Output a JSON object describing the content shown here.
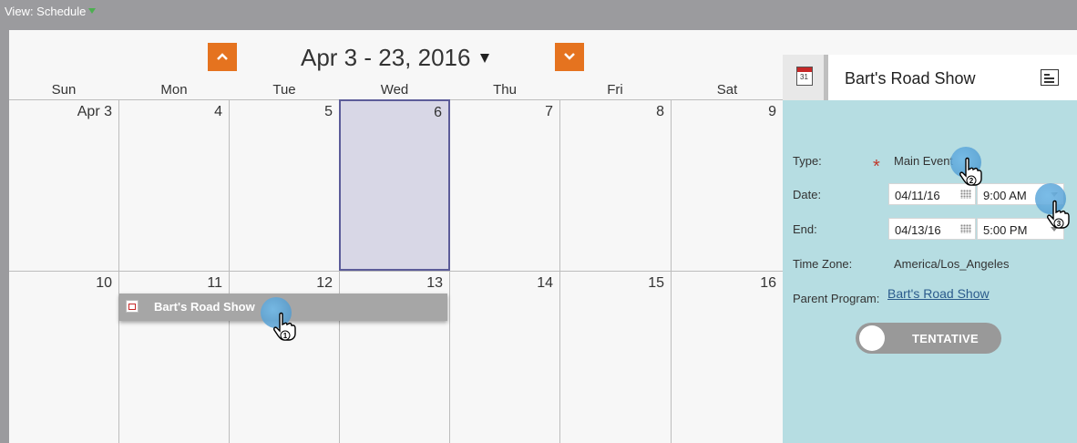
{
  "toolbar": {
    "view_label": "View: Schedule"
  },
  "calendar": {
    "range_title": "Apr 3 - 23, 2016",
    "weekdays": [
      "Sun",
      "Mon",
      "Tue",
      "Wed",
      "Thu",
      "Fri",
      "Sat"
    ],
    "week1": [
      "Apr 3",
      "4",
      "5",
      "6",
      "7",
      "8",
      "9"
    ],
    "week2": [
      "10",
      "11",
      "12",
      "13",
      "14",
      "15",
      "16"
    ],
    "event": {
      "label": "Bart's Road Show"
    }
  },
  "side_panel": {
    "title": "Bart's Road Show",
    "type_label": "Type:",
    "type_value": "Main Event",
    "date_label": "Date:",
    "date_value": "04/11/16",
    "start_time": "9:00 AM",
    "end_label": "End:",
    "end_date": "04/13/16",
    "end_time": "5:00 PM",
    "timezone_label": "Time Zone:",
    "timezone_value": "America/Los_Angeles",
    "parent_label": "Parent Program:",
    "parent_value": "Bart's Road Show",
    "toggle_label": "TENTATIVE"
  },
  "markers": [
    "1",
    "2",
    "3"
  ],
  "colors": {
    "accent": "#e5731f",
    "panel": "#b6dde2",
    "today": "#d8d7e6",
    "required": "#c0392b"
  },
  "icons": [
    "chevron-up-icon",
    "chevron-down-icon",
    "calendar-icon",
    "document-icon",
    "grid-calendar-icon",
    "pointer-hand-icon"
  ]
}
